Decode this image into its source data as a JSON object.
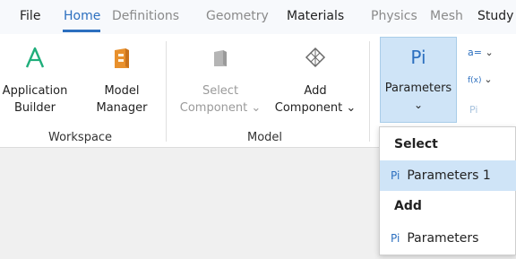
{
  "menubar": {
    "tabs": [
      {
        "label": "File"
      },
      {
        "label": "Home"
      },
      {
        "label": "Definitions"
      },
      {
        "label": "Geometry"
      },
      {
        "label": "Materials"
      },
      {
        "label": "Physics"
      },
      {
        "label": "Mesh"
      },
      {
        "label": "Study"
      }
    ],
    "active_tab": "Home"
  },
  "ribbon": {
    "workspace": {
      "group_label": "Workspace",
      "application_builder": {
        "line1": "Application",
        "line2": "Builder",
        "icon": "application-builder-icon"
      },
      "model_manager": {
        "line1": "Model",
        "line2": "Manager",
        "icon": "model-manager-icon"
      }
    },
    "model": {
      "group_label": "Model",
      "select_component": {
        "line1": "Select",
        "line2": "Component ⌄",
        "icon": "component-icon"
      },
      "add_component": {
        "line1": "Add",
        "line2": "Component ⌄",
        "icon": "add-component-icon"
      }
    },
    "definitions": {
      "parameters": {
        "label": "Parameters",
        "chevron": "⌄",
        "icon": "parameters-icon",
        "glyph": "Pi"
      },
      "small_buttons": [
        {
          "glyph": "a=",
          "chevron": "⌄",
          "icon": "variables-icon"
        },
        {
          "glyph": "f(x)",
          "chevron": "⌄",
          "icon": "functions-icon"
        },
        {
          "glyph": "Pi",
          "chevron": "",
          "icon": "parameter-case-icon"
        }
      ]
    }
  },
  "dropdown": {
    "sections": [
      {
        "header": "Select",
        "items": [
          {
            "glyph": "Pi",
            "label": "Parameters 1",
            "highlighted": true
          }
        ]
      },
      {
        "header": "Add",
        "items": [
          {
            "glyph": "Pi",
            "label": "Parameters",
            "highlighted": false
          }
        ]
      }
    ]
  },
  "colors": {
    "accent": "#2c6fbf",
    "app_builder_green": "#1fae7b",
    "model_manager_orange": "#e8902c",
    "selected_bg": "#cfe4f7"
  }
}
